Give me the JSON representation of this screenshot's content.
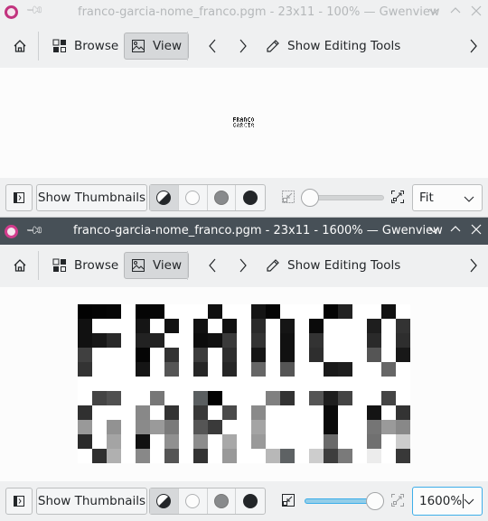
{
  "windows": [
    {
      "state": "inactive",
      "title": "franco-garcia-nome_franco.pgm - 23x11 - 100% — Gwenview",
      "toolbar": {
        "browse_label": "Browse",
        "view_label": "View",
        "edit_label": "Show Editing Tools"
      },
      "bottombar": {
        "thumbnails_label": "Show Thumbnails",
        "zoom_value": "Fit",
        "zoom_slider_percent": 0
      }
    },
    {
      "state": "active",
      "title": "franco-garcia-nome_franco.pgm - 23x11 - 1600% — Gwenview",
      "toolbar": {
        "browse_label": "Browse",
        "view_label": "View",
        "edit_label": "Show Editing Tools"
      },
      "bottombar": {
        "thumbnails_label": "Show Thumbnails",
        "zoom_value": "1600%",
        "zoom_slider_percent": 100
      }
    }
  ],
  "icons": {
    "app": "gwenview-app-icon",
    "pin": "pin-icon",
    "minimize": "chevron-down-icon",
    "maximize": "chevron-up-icon",
    "close": "close-icon",
    "home": "home-icon",
    "browse": "grid-icon",
    "view": "image-icon",
    "prev": "chevron-left-icon",
    "next": "chevron-right-icon",
    "edit": "pencil-icon",
    "more": "chevron-right-icon",
    "sidebar": "sidebar-toggle-icon",
    "bg_auto": "contrast-icon",
    "bg_light": "white-circle-icon",
    "bg_neutral": "gray-circle-icon",
    "bg_dark": "black-circle-icon",
    "zoom_fit": "zoom-fit-icon",
    "zoom_fill": "zoom-fill-icon"
  },
  "colors": {
    "accent": "#3daee9",
    "active_titlebar": "#475057",
    "window_bg": "#eff0f1",
    "view_bg": "#fcfcfc",
    "app_icon": "#d13c8c"
  },
  "image": {
    "width": 23,
    "height": 11,
    "text_lines": [
      "FRANCO",
      "GARCIA"
    ],
    "pixels": [
      [
        "#020202",
        "#040404",
        "#060606",
        "#ffffff",
        "#050505",
        "#060606",
        "#ffffff",
        "#ffffff",
        "#ffffff",
        "#101010",
        "#ffffff",
        "#ffffff",
        "#141414",
        "#050505",
        "#ffffff",
        "#ffffff",
        "#ffffff",
        "#050505",
        "#222222",
        "#ffffff",
        "#ffffff",
        "#111111",
        "#ffffff"
      ],
      [
        "#111111",
        "#ffffff",
        "#ffffff",
        "#ffffff",
        "#151515",
        "#ffffff",
        "#121212",
        "#ffffff",
        "#111111",
        "#ffffff",
        "#111111",
        "#ffffff",
        "#2a2a2a",
        "#ffffff",
        "#151515",
        "#ffffff",
        "#0a0a0a",
        "#ffffff",
        "#ffffff",
        "#ffffff",
        "#1e1e1e",
        "#ffffff",
        "#333333"
      ],
      [
        "#111111",
        "#181818",
        "#2a2a2a",
        "#ffffff",
        "#222222",
        "#222222",
        "#ffffff",
        "#ffffff",
        "#0c0c0c",
        "#111111",
        "#3a3a3a",
        "#ffffff",
        "#333333",
        "#ffffff",
        "#111111",
        "#ffffff",
        "#333333",
        "#ffffff",
        "#ffffff",
        "#ffffff",
        "#2a2a2a",
        "#ffffff",
        "#2e2e2e"
      ],
      [
        "#404040",
        "#ffffff",
        "#ffffff",
        "#ffffff",
        "#050505",
        "#ffffff",
        "#333333",
        "#ffffff",
        "#3c3c3c",
        "#ffffff",
        "#2e2e2e",
        "#ffffff",
        "#151515",
        "#ffffff",
        "#111111",
        "#ffffff",
        "#2e2e2e",
        "#ffffff",
        "#ffffff",
        "#ffffff",
        "#555555",
        "#ffffff",
        "#181818"
      ],
      [
        "#333333",
        "#ffffff",
        "#ffffff",
        "#ffffff",
        "#151515",
        "#ffffff",
        "#555555",
        "#ffffff",
        "#262626",
        "#ffffff",
        "#262626",
        "#ffffff",
        "#666666",
        "#ffffff",
        "#555555",
        "#ffffff",
        "#ffffff",
        "#1a1a1a",
        "#1e1e1e",
        "#ffffff",
        "#ffffff",
        "#666666",
        "#ffffff"
      ],
      [
        "#ffffff",
        "#ffffff",
        "#ffffff",
        "#ffffff",
        "#ffffff",
        "#ffffff",
        "#ffffff",
        "#ffffff",
        "#ffffff",
        "#ffffff",
        "#ffffff",
        "#ffffff",
        "#ffffff",
        "#ffffff",
        "#ffffff",
        "#ffffff",
        "#ffffff",
        "#ffffff",
        "#ffffff",
        "#ffffff",
        "#ffffff",
        "#ffffff",
        "#ffffff"
      ],
      [
        "#ffffff",
        "#444444",
        "#505050",
        "#ffffff",
        "#ffffff",
        "#777777",
        "#ffffff",
        "#ffffff",
        "#5a5e60",
        "#020202",
        "#ffffff",
        "#ffffff",
        "#ffffff",
        "#808080",
        "#333333",
        "#ffffff",
        "#555555",
        "#1e1e1e",
        "#444444",
        "#ffffff",
        "#ffffff",
        "#444444",
        "#ffffff"
      ],
      [
        "#303030",
        "#ffffff",
        "#ffffff",
        "#ffffff",
        "#888888",
        "#ffffff",
        "#333333",
        "#ffffff",
        "#383838",
        "#ffffff",
        "#4a4a4a",
        "#ffffff",
        "#8a8a8a",
        "#ffffff",
        "#ffffff",
        "#ffffff",
        "#ffffff",
        "#0a0a0a",
        "#ffffff",
        "#ffffff",
        "#141414",
        "#ffffff",
        "#333333"
      ],
      [
        "#999999",
        "#ffffff",
        "#929292",
        "#ffffff",
        "#8a8a8a",
        "#9a9a9a",
        "#7a7a7a",
        "#ffffff",
        "#555555",
        "#3a3a3a",
        "#ffffff",
        "#ffffff",
        "#a4a4a4",
        "#ffffff",
        "#ffffff",
        "#ffffff",
        "#ffffff",
        "#0a0a0a",
        "#ffffff",
        "#ffffff",
        "#757575",
        "#9a9a9a",
        "#888888"
      ],
      [
        "#2a2a2a",
        "#ffffff",
        "#a4a4a4",
        "#ffffff",
        "#111111",
        "#ffffff",
        "#909090",
        "#ffffff",
        "#8c8c8c",
        "#ffffff",
        "#a8a8a8",
        "#ffffff",
        "#9a9a9a",
        "#ffffff",
        "#ffffff",
        "#ffffff",
        "#ffffff",
        "#6a6a6a",
        "#ffffff",
        "#ffffff",
        "#707070",
        "#ffffff",
        "#cccccc"
      ],
      [
        "#ffffff",
        "#303030",
        "#b0b0b0",
        "#ffffff",
        "#888888",
        "#ffffff",
        "#555555",
        "#ffffff",
        "#333333",
        "#ffffff",
        "#999999",
        "#ffffff",
        "#ffffff",
        "#b8b8b8",
        "#5e6264",
        "#ffffff",
        "#cdcdcd",
        "#3e3e3e",
        "#7a7a7a",
        "#ffffff",
        "#ececec",
        "#ffffff",
        "#383838"
      ]
    ]
  }
}
